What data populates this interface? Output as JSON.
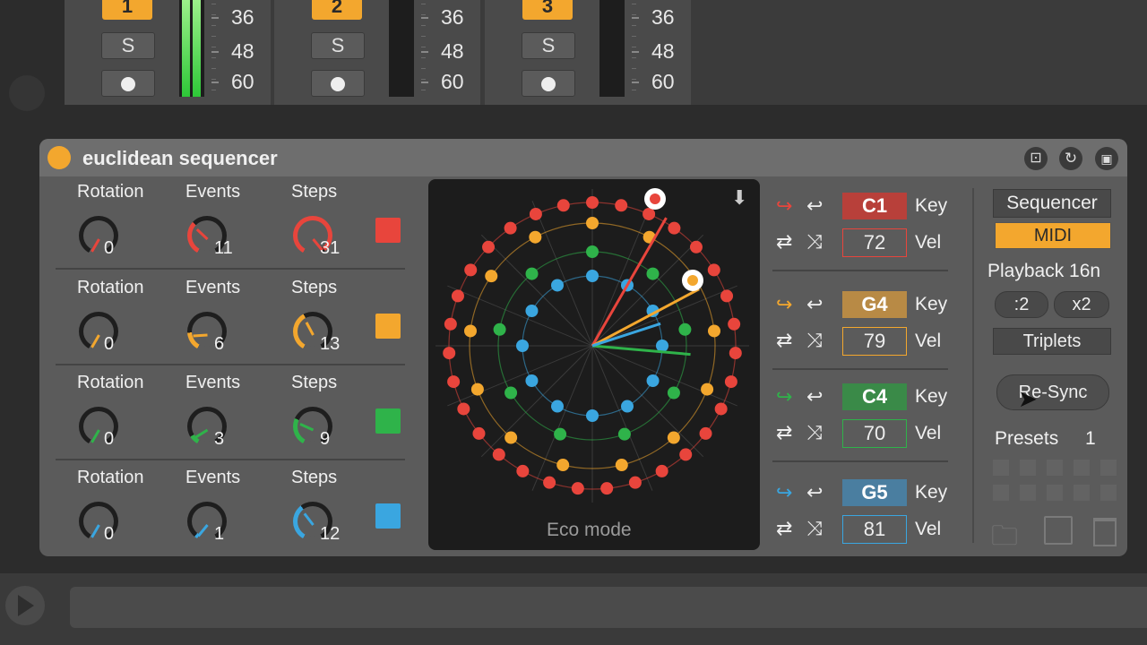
{
  "mixer": {
    "tracks": [
      {
        "number": "1",
        "solo": "S",
        "scale": [
          "36",
          "48",
          "60"
        ]
      },
      {
        "number": "2",
        "solo": "S",
        "scale": [
          "36",
          "48",
          "60"
        ]
      },
      {
        "number": "3",
        "solo": "S",
        "scale": [
          "36",
          "48",
          "60"
        ]
      }
    ]
  },
  "device": {
    "title": "euclidean sequencer",
    "rows": [
      {
        "rotation_label": "Rotation",
        "events_label": "Events",
        "steps_label": "Steps",
        "rotation": "0",
        "events": "11",
        "steps": "31",
        "color": "#e8453c"
      },
      {
        "rotation_label": "Rotation",
        "events_label": "Events",
        "steps_label": "Steps",
        "rotation": "0",
        "events": "6",
        "steps": "13",
        "color": "#f3a72e"
      },
      {
        "rotation_label": "Rotation",
        "events_label": "Events",
        "steps_label": "Steps",
        "rotation": "0",
        "events": "3",
        "steps": "9",
        "color": "#2fb34a"
      },
      {
        "rotation_label": "Rotation",
        "events_label": "Events",
        "steps_label": "Steps",
        "rotation": "0",
        "events": "1",
        "steps": "12",
        "color": "#3aa6e0"
      }
    ],
    "eco_mode": "Eco mode",
    "notes": [
      {
        "note": "C1",
        "key_label": "Key",
        "vel": "72",
        "vel_label": "Vel",
        "color": "#e8453c",
        "bg": "#b8403a"
      },
      {
        "note": "G4",
        "key_label": "Key",
        "vel": "79",
        "vel_label": "Vel",
        "color": "#f3a72e",
        "bg": "#b88a45"
      },
      {
        "note": "C4",
        "key_label": "Key",
        "vel": "70",
        "vel_label": "Vel",
        "color": "#2fb34a",
        "bg": "#3a8a48"
      },
      {
        "note": "G5",
        "key_label": "Key",
        "vel": "81",
        "vel_label": "Vel",
        "color": "#3aa6e0",
        "bg": "#4a7ea0"
      }
    ],
    "right": {
      "sequencer": "Sequencer",
      "midi": "MIDI",
      "playback": "Playback 16n",
      "half": ":2",
      "double": "x2",
      "triplets": "Triplets",
      "resync": "Re-Sync",
      "presets_label": "Presets",
      "presets_value": "1"
    }
  }
}
